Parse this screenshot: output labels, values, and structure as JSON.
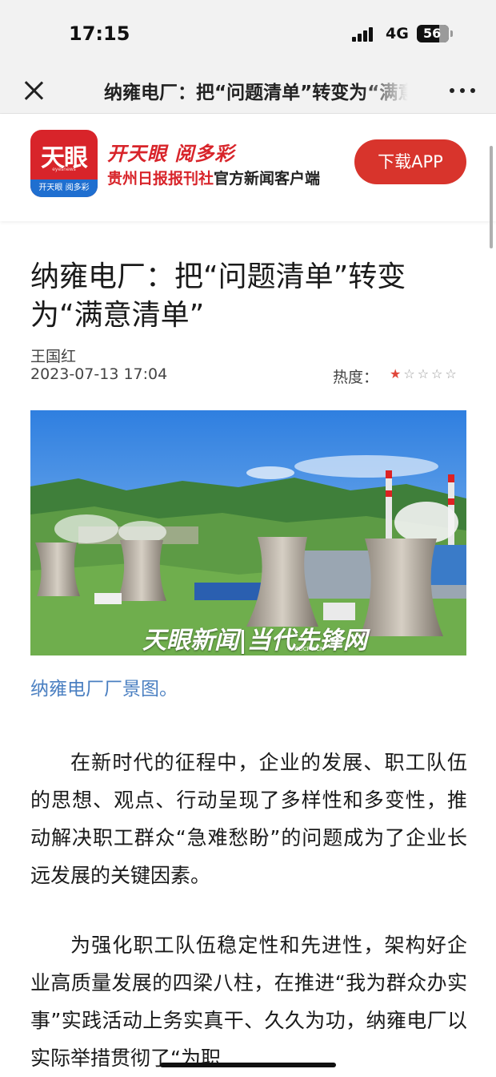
{
  "status_bar": {
    "time": "17:15",
    "network": "4G",
    "battery": "56"
  },
  "nav": {
    "title": "纳雍电厂：把“问题清单”转变为“满意清单”"
  },
  "banner": {
    "logo_text": "天眼",
    "logo_small": "eyesnews",
    "logo_bar": "开天眼 阅多彩",
    "slogan": "开天眼 阅多彩",
    "sub_red": "贵州日报报刊社",
    "sub_black": "官方新闻客户端",
    "download": "下载APP"
  },
  "article": {
    "title": "纳雍电厂：把“问题清单”转变为“满意清单”",
    "author": "王国红",
    "date": "2023-07-13 17:04",
    "heat_label": "热度：",
    "heat_rating": {
      "value": 1,
      "max": 5
    },
    "image_watermark": "天眼新闻|当代先锋网",
    "image_watermark_small": "DDCPC.CN",
    "caption": "纳雍电厂厂景图。",
    "paragraphs": [
      "在新时代的征程中，企业的发展、职工队伍的思想、观点、行动呈现了多样性和多变性，推动解决职工群众“急难愁盼”的问题成为了企业长远发展的关键因素。",
      "为强化职工队伍稳定性和先进性，架构好企业高质量发展的四梁八柱，在推进“我为群众办实事”实践活动上务实真干、久久为功，纳雍电厂以实际举措贯彻了“为职"
    ]
  },
  "colors": {
    "brand_red": "#d8242a",
    "button_red": "#d8342c",
    "caption_blue": "#4a7fc1",
    "logo_blue": "#1f6fd0"
  }
}
